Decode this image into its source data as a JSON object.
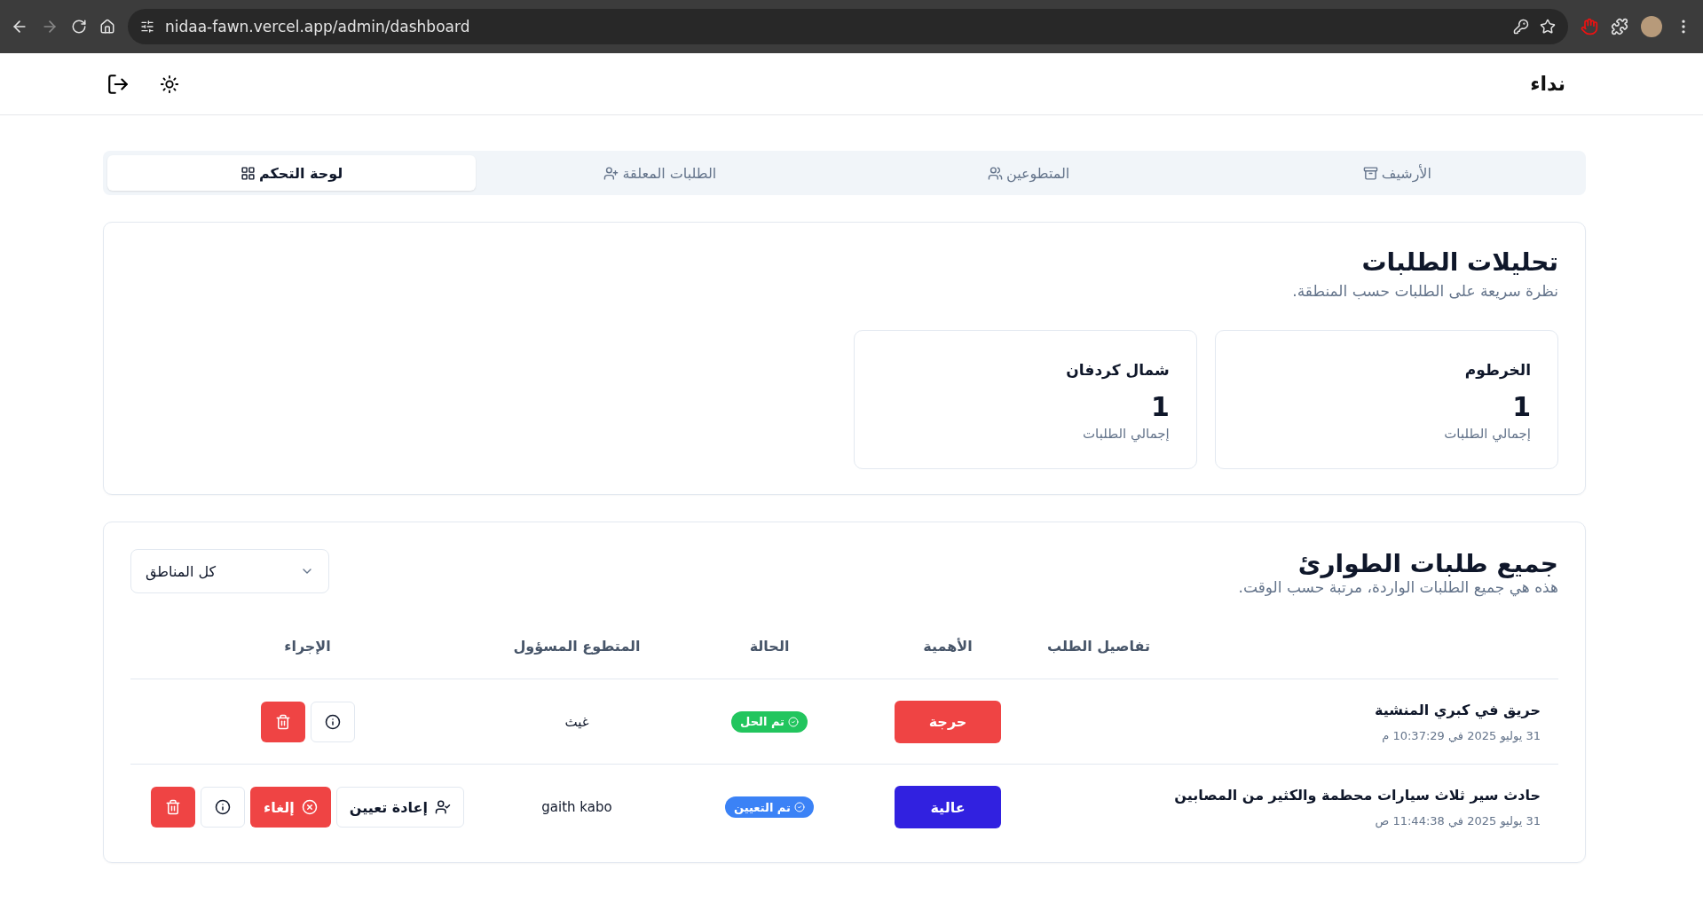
{
  "browser": {
    "url": "nidaa-fawn.vercel.app/admin/dashboard"
  },
  "header": {
    "brand": "نداء"
  },
  "tabs": [
    {
      "label": "الأرشيف",
      "kind": "archive",
      "selected": false
    },
    {
      "label": "المتطوعين",
      "kind": "volunteers",
      "selected": false
    },
    {
      "label": "الطلبات المعلقة",
      "kind": "pending",
      "selected": false
    },
    {
      "label": "لوحة التحكم",
      "kind": "dashboard",
      "selected": true
    }
  ],
  "analytics": {
    "title": "تحليلات الطلبات",
    "subtitle": "نظرة سريعة على الطلبات حسب المنطقة.",
    "regions": [
      {
        "name": "الخرطوم",
        "count": "1",
        "caption": "إجمالي الطلبات"
      },
      {
        "name": "شمال كردفان",
        "count": "1",
        "caption": "إجمالي الطلبات"
      }
    ]
  },
  "requests": {
    "title": "جميع طلبات الطوارئ",
    "subtitle": "هذه هي جميع الطلبات الواردة، مرتبة حسب الوقت.",
    "filter": {
      "value": "كل المناطق"
    },
    "columns": [
      "تفاصيل الطلب",
      "الأهمية",
      "الحالة",
      "المتطوع المسؤول",
      "الإجراء"
    ],
    "rows": [
      {
        "title": "حريق في كبري المنشية",
        "time": "31 يوليو 2025 في 10:37:29 م",
        "priority": {
          "label": "حرجة",
          "color": "#ef4444"
        },
        "status": {
          "label": "تم الحل",
          "color": "#22c55e"
        },
        "volunteer": "غيث",
        "actions": [
          {
            "kind": "info"
          },
          {
            "kind": "delete"
          }
        ]
      },
      {
        "title": "حادث سير ثلاث سيارات محطمة والكثير من المصابين",
        "time": "31 يوليو 2025 في 11:44:38 ص",
        "priority": {
          "label": "عالية",
          "color": "#3121e0"
        },
        "status": {
          "label": "تم التعيين",
          "color": "#3b82f6"
        },
        "volunteer": "gaith kabo",
        "actions": [
          {
            "kind": "reassign",
            "label": "إعادة تعيين"
          },
          {
            "kind": "cancel",
            "label": "إلغاء"
          },
          {
            "kind": "info"
          },
          {
            "kind": "delete"
          }
        ]
      }
    ]
  }
}
